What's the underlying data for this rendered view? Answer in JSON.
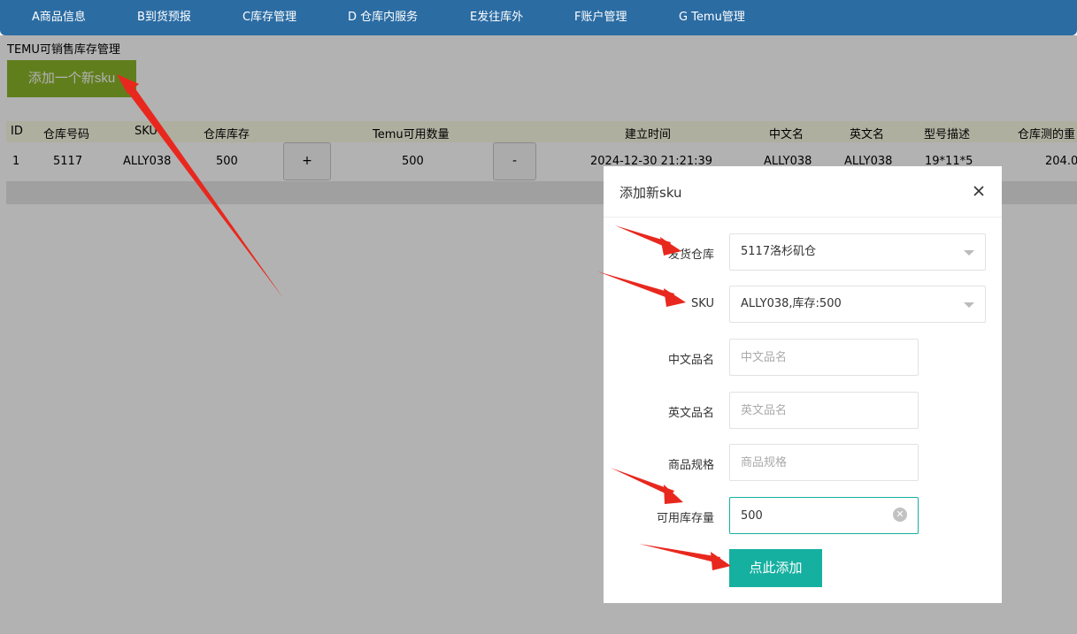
{
  "nav": {
    "items": [
      "A商品信息",
      "B到货预报",
      "C库存管理",
      "D 仓库内服务",
      "E发往库外",
      "F账户管理",
      "G Temu管理"
    ]
  },
  "page": {
    "title": "TEMU可销售库存管理",
    "add_button": "添加一个新sku"
  },
  "table": {
    "headers": [
      "ID",
      "仓库号码",
      "SKU",
      "仓库库存",
      "Temu可用数量",
      "建立时间",
      "中文名",
      "英文名",
      "型号描述",
      "仓库测的重"
    ],
    "row": {
      "id": "1",
      "warehouse": "5117",
      "sku": "ALLY038",
      "stock": "500",
      "plus": "+",
      "temu_qty": "500",
      "minus": "-",
      "created": "2024-12-30 21:21:39",
      "cn_name": "ALLY038",
      "en_name": "ALLY038",
      "model": "19*11*5",
      "weight": "204.0"
    }
  },
  "dialog": {
    "title": "添加新sku",
    "fields": {
      "warehouse_label": "发货仓库",
      "warehouse_value": "5117洛杉矶仓",
      "sku_label": "SKU",
      "sku_value": "ALLY038,库存:500",
      "cn_label": "中文品名",
      "cn_placeholder": "中文品名",
      "en_label": "英文品名",
      "en_placeholder": "英文品名",
      "spec_label": "商品规格",
      "spec_placeholder": "商品规格",
      "qty_label": "可用库存量",
      "qty_value": "500"
    },
    "submit": "点此添加"
  },
  "colors": {
    "nav": "#2b6ca3",
    "add_button": "#8bb52a",
    "accent": "#16b0a0",
    "arrow": "#e8281e"
  },
  "icons": [
    "close-icon",
    "clear-icon",
    "caret-down-icon"
  ]
}
